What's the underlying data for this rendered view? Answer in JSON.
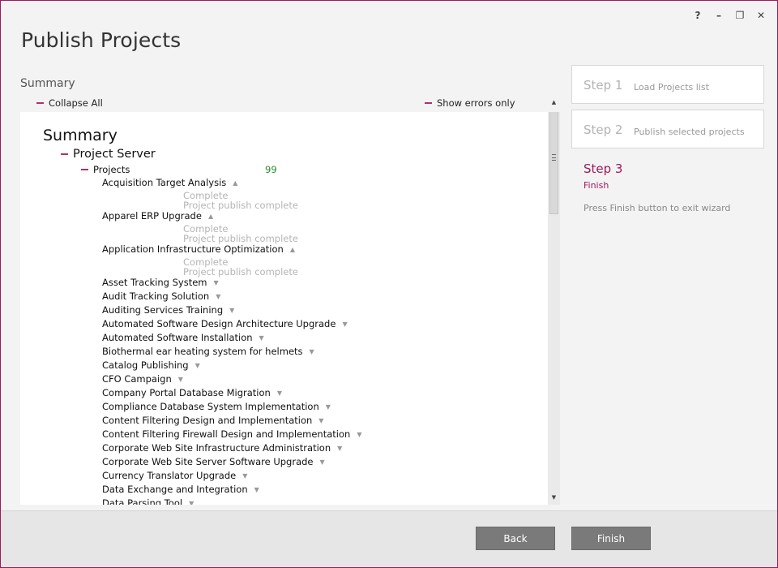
{
  "window": {
    "title": "Publish Projects",
    "controls": {
      "help": "?",
      "minimize": "–",
      "restore": "❐",
      "close": "✕"
    }
  },
  "summary_section": {
    "label": "Summary",
    "collapse_all": "Collapse All",
    "show_errors_only": "Show errors only"
  },
  "tree": {
    "root": "Summary",
    "server": "Project Server",
    "projects_label": "Projects",
    "projects_count": "99",
    "items": [
      {
        "name": "Acquisition Target Analysis",
        "expanded": true,
        "status": "Complete",
        "message": "Project publish complete"
      },
      {
        "name": "Apparel ERP Upgrade",
        "expanded": true,
        "status": "Complete",
        "message": "Project publish complete"
      },
      {
        "name": "Application Infrastructure Optimization",
        "expanded": true,
        "status": "Complete",
        "message": "Project publish complete"
      },
      {
        "name": "Asset Tracking System",
        "expanded": false
      },
      {
        "name": "Audit Tracking Solution",
        "expanded": false
      },
      {
        "name": "Auditing Services Training",
        "expanded": false
      },
      {
        "name": "Automated Software Design Architecture Upgrade",
        "expanded": false
      },
      {
        "name": "Automated Software Installation",
        "expanded": false
      },
      {
        "name": "Biothermal ear heating system for helmets",
        "expanded": false
      },
      {
        "name": "Catalog Publishing",
        "expanded": false
      },
      {
        "name": "CFO Campaign",
        "expanded": false
      },
      {
        "name": "Company Portal Database Migration",
        "expanded": false
      },
      {
        "name": "Compliance Database System Implementation",
        "expanded": false
      },
      {
        "name": "Content Filtering Design and Implementation",
        "expanded": false
      },
      {
        "name": "Content Filtering Firewall Design and Implementation",
        "expanded": false
      },
      {
        "name": "Corporate Web Site Infrastructure Administration",
        "expanded": false
      },
      {
        "name": "Corporate Web Site Server Software Upgrade",
        "expanded": false
      },
      {
        "name": "Currency Translator Upgrade",
        "expanded": false
      },
      {
        "name": "Data Exchange and Integration",
        "expanded": false
      },
      {
        "name": "Data Parsing Tool",
        "expanded": false
      }
    ]
  },
  "steps": {
    "step1": {
      "number": "Step 1",
      "desc": "Load Projects list"
    },
    "step2": {
      "number": "Step 2",
      "desc": "Publish selected projects"
    },
    "step3": {
      "number": "Step 3",
      "desc": "Finish",
      "note": "Press Finish button to exit wizard"
    }
  },
  "footer": {
    "back": "Back",
    "finish": "Finish"
  },
  "colors": {
    "accent": "#a0185a",
    "count_green": "#2f8a2f",
    "button_gray": "#7a7a7a"
  },
  "icons": {
    "expanded": "caret-up-icon",
    "collapsed": "caret-down-icon"
  }
}
